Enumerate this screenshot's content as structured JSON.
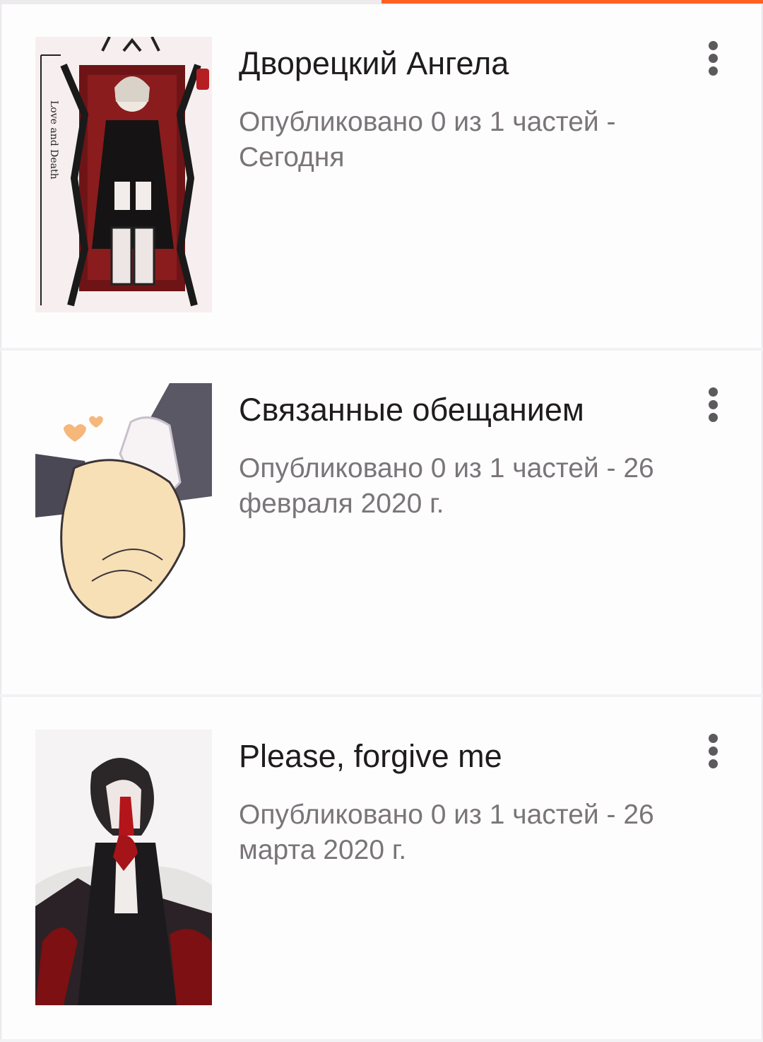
{
  "colors": {
    "accent": "#ff6122",
    "title_text": "#1f1c1e",
    "meta_text": "#797578",
    "card_background": "#fefdfe",
    "page_background": "#f2f1f3"
  },
  "stories": [
    {
      "title": "Дворецкий Ангела",
      "status": "Опубликовано 0 из 1 частей - Сегодня",
      "cover_art_text": "Love and Death",
      "menu_icon": "more-vertical-icon"
    },
    {
      "title": "Связанные обещанием",
      "status": "Опубликовано 0 из 1 частей - 26 февраля 2020 г.",
      "menu_icon": "more-vertical-icon"
    },
    {
      "title": "Please, forgive me",
      "status": "Опубликовано 0 из 1 частей - 26 марта 2020 г.",
      "menu_icon": "more-vertical-icon"
    }
  ]
}
